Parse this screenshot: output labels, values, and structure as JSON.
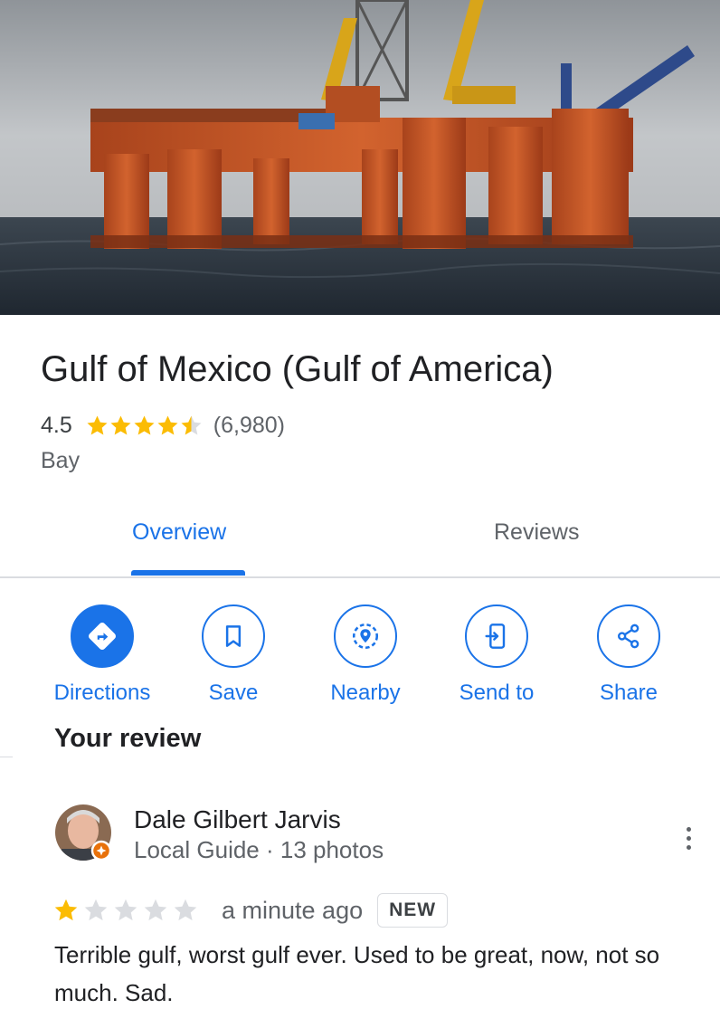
{
  "place": {
    "title": "Gulf of Mexico (Gulf of America)",
    "rating": "4.5",
    "rating_value": 4.5,
    "review_count": "(6,980)",
    "category": "Bay"
  },
  "tabs": [
    {
      "label": "Overview",
      "active": true
    },
    {
      "label": "Reviews",
      "active": false
    }
  ],
  "actions": [
    {
      "label": "Directions",
      "icon": "directions-icon"
    },
    {
      "label": "Save",
      "icon": "bookmark-icon"
    },
    {
      "label": "Nearby",
      "icon": "nearby-icon"
    },
    {
      "label": "Send to",
      "icon": "send-to-phone-icon"
    },
    {
      "label": "Share",
      "icon": "share-icon"
    }
  ],
  "your_review": {
    "heading": "Your review",
    "reviewer": {
      "name": "Dale Gilbert Jarvis",
      "meta": "Local Guide · 13 photos"
    },
    "stars": 1,
    "time": "a minute ago",
    "badge": "NEW",
    "text": "Terrible gulf, worst gulf ever. Used to be great, now, not so much. Sad."
  },
  "colors": {
    "accent": "#1a73e8",
    "star": "#fbbc04",
    "star_empty": "#dadce0",
    "text": "#202124",
    "secondary": "#5f6368"
  }
}
